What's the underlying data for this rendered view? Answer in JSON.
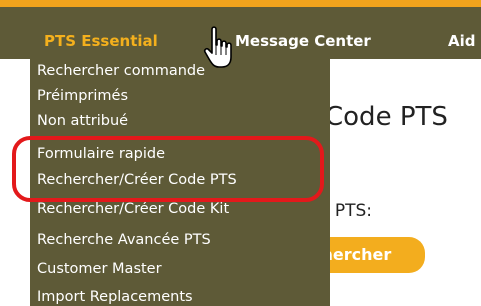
{
  "nav": {
    "pts_essential": "PTS Essential",
    "message_center": "Message Center",
    "aide_partial": "Aid"
  },
  "page": {
    "title_partial": "Code PTS",
    "field_label_partial": "e PTS:",
    "search_button_partial": "chercher"
  },
  "menu": {
    "items": [
      "Rechercher commande",
      "Préimprimés",
      "Non attribué",
      "Formulaire rapide",
      "Rechercher/Créer Code PTS",
      "Rechercher/Créer Code Kit",
      "Recherche Avancée PTS",
      "Customer Master",
      "Import Replacements"
    ]
  },
  "annotation": {
    "color": "#e3191b"
  },
  "colors": {
    "nav_bg": "#5e5a37",
    "accent": "#f4b01d"
  },
  "cursor": {
    "icon": "hand-pointer-icon"
  }
}
